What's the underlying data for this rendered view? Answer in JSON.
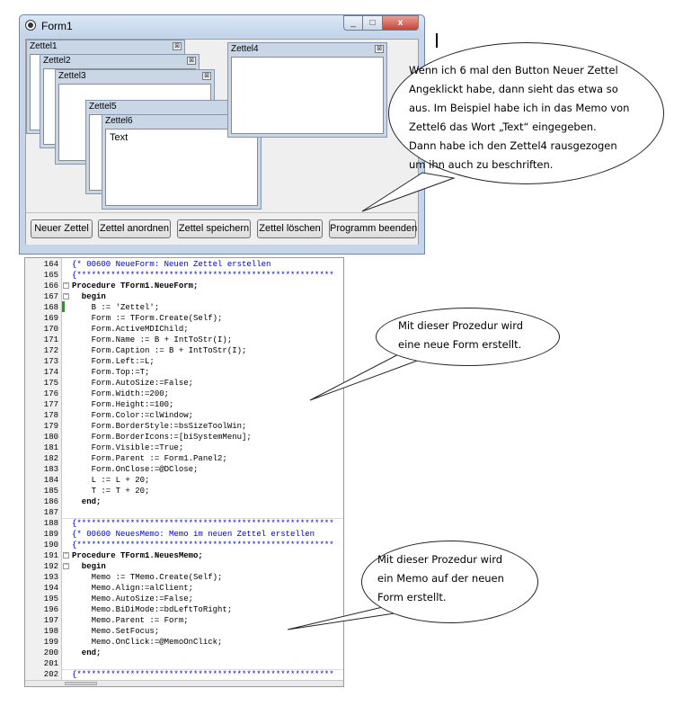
{
  "window": {
    "title": "Form1",
    "controls": {
      "minimize": "_",
      "maximize": "□",
      "close": "x"
    }
  },
  "zettel": [
    {
      "title": "Zettel1",
      "memo": ""
    },
    {
      "title": "Zettel2",
      "memo": ""
    },
    {
      "title": "Zettel3",
      "memo": ""
    },
    {
      "title": "Zettel5",
      "memo": ""
    },
    {
      "title": "Zettel6",
      "memo": "Text"
    },
    {
      "title": "Zettel4",
      "memo": ""
    }
  ],
  "child_close_glyph": "⊠",
  "buttons": {
    "neuer_zettel": "Neuer Zettel",
    "zettel_anordnen": "Zettel anordnen",
    "zettel_speichern": "Zettel speichern",
    "zettel_loeschen": "Zettel löschen",
    "programm_beenden": "Programm beenden"
  },
  "callouts": {
    "top": [
      "Wenn ich 6 mal den Button Neuer Zettel",
      "Angeklickt habe, dann sieht das etwa so",
      "aus.  Im Beispiel habe ich in das Memo von",
      "Zettel6 das Wort „Text“ eingegeben.",
      "Dann habe ich den Zettel4 rausgezogen",
      "um ihn auch zu beschriften."
    ],
    "middle": [
      "Mit dieser Prozedur wird",
      "eine neue Form erstellt."
    ],
    "bottom": [
      "Mit dieser Prozedur wird",
      "ein Memo auf der neuen",
      "Form erstellt."
    ]
  },
  "code_lines": [
    {
      "n": "164",
      "t": "{* 00600 NeueForm: Neuen Zettel erstellen",
      "c": true
    },
    {
      "n": "165",
      "t": "{*****************************************************",
      "c": true
    },
    {
      "n": "166",
      "t": "Procedure TForm1.NeueForm;",
      "b": true
    },
    {
      "n": "167",
      "t": "  begin",
      "b": true
    },
    {
      "n": "168",
      "t": "    B := 'Zettel';"
    },
    {
      "n": "169",
      "t": "    Form := TForm.Create(Self);"
    },
    {
      "n": "170",
      "t": "    Form.ActiveMDIChild;"
    },
    {
      "n": "171",
      "t": "    Form.Name := B + IntToStr(I);"
    },
    {
      "n": "172",
      "t": "    Form.Caption := B + IntToStr(I);"
    },
    {
      "n": "173",
      "t": "    Form.Left:=L;"
    },
    {
      "n": "174",
      "t": "    Form.Top:=T;"
    },
    {
      "n": "175",
      "t": "    Form.AutoSize:=False;"
    },
    {
      "n": "176",
      "t": "    Form.Width:=200;"
    },
    {
      "n": "177",
      "t": "    Form.Height:=100;"
    },
    {
      "n": "178",
      "t": "    Form.Color:=clWindow;"
    },
    {
      "n": "179",
      "t": "    Form.BorderStyle:=bsSizeToolWin;"
    },
    {
      "n": "180",
      "t": "    Form.BorderIcons:=[biSystemMenu];"
    },
    {
      "n": "181",
      "t": "    Form.Visible:=True;"
    },
    {
      "n": "182",
      "t": "    Form.Parent := Form1.Panel2;"
    },
    {
      "n": "183",
      "t": "    Form.OnClose:=@DClose;"
    },
    {
      "n": "184",
      "t": "    L := L + 20;"
    },
    {
      "n": "185",
      "t": "    T := T + 20;"
    },
    {
      "n": "186",
      "t": "  end;",
      "b": true
    },
    {
      "n": "187",
      "t": ""
    },
    {
      "n": "188",
      "t": "{*****************************************************",
      "c": true
    },
    {
      "n": "189",
      "t": "{* 00600 NeuesMemo: Memo im neuen Zettel erstellen",
      "c": true
    },
    {
      "n": "190",
      "t": "{*****************************************************",
      "c": true
    },
    {
      "n": "191",
      "t": "Procedure TForm1.NeuesMemo;",
      "b": true
    },
    {
      "n": "192",
      "t": "  begin",
      "b": true
    },
    {
      "n": "193",
      "t": "    Memo := TMemo.Create(Self);"
    },
    {
      "n": "194",
      "t": "    Memo.Align:=alClient;"
    },
    {
      "n": "195",
      "t": "    Memo.AutoSize:=False;"
    },
    {
      "n": "196",
      "t": "    Memo.BiDiMode:=bdLeftToRight;"
    },
    {
      "n": "197",
      "t": "    Memo.Parent := Form;"
    },
    {
      "n": "198",
      "t": "    Memo.SetFocus;"
    },
    {
      "n": "199",
      "t": "    Memo.OnClick:=@MemoOnClick;"
    },
    {
      "n": "200",
      "t": "  end;",
      "b": true
    },
    {
      "n": "201",
      "t": ""
    },
    {
      "n": "202",
      "t": "{*****************************************************",
      "c": true
    }
  ],
  "colors": {
    "comment": "#0000cc",
    "change_bar": "#17a317",
    "close_button": "#c4453a"
  }
}
